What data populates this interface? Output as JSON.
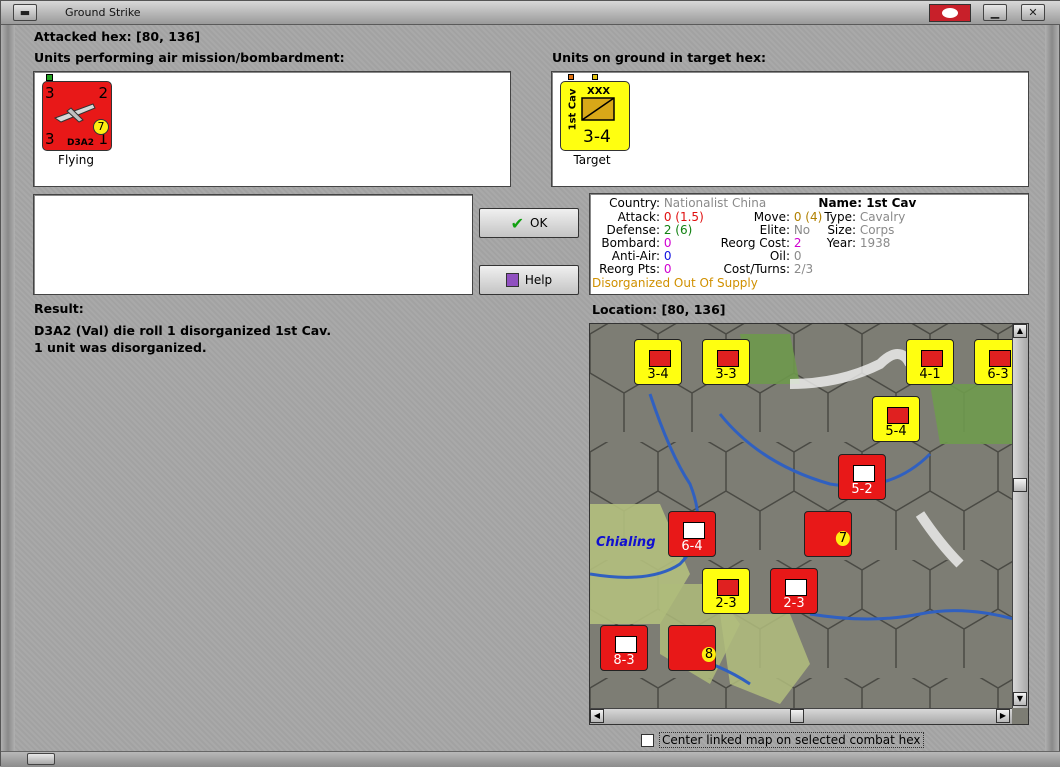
{
  "window": {
    "title": "Ground Strike"
  },
  "attacked_hex": "Attacked hex:  [80, 136]",
  "air_units_label": "Units performing air mission/bombardment:",
  "ground_units_label": "Units on ground in target hex:",
  "air_unit": {
    "name": "D3A2",
    "top_left": "3",
    "top_right": "2",
    "bottom_left": "3",
    "bottom_right": "1",
    "badge": "7",
    "caption": "Flying"
  },
  "ground_unit": {
    "name": "1st Cav",
    "size_mark": "XXX",
    "strength": "3-4",
    "caption": "Target"
  },
  "buttons": {
    "ok": "OK",
    "help": "Help"
  },
  "info": {
    "country_label": "Country:",
    "country": "Nationalist China",
    "attack_label": "Attack:",
    "attack": "0",
    "attack_mod": "(1.5)",
    "defense_label": "Defense:",
    "defense": "2",
    "defense_mod": "(6)",
    "bombard_label": "Bombard:",
    "bombard": "0",
    "antiair_label": "Anti-Air:",
    "antiair": "0",
    "reorg_label": "Reorg Pts:",
    "reorg": "0",
    "move_label": "Move:",
    "move": "0",
    "move_mod": "(4)",
    "elite_label": "Elite:",
    "elite": "No",
    "reorgcost_label": "Reorg Cost:",
    "reorgcost": "2",
    "oil_label": "Oil:",
    "oil": "0",
    "costturns_label": "Cost/Turns:",
    "costturns": "2/3",
    "name_label": "Name:",
    "name": "1st Cav",
    "type_label": "Type:",
    "type": "Cavalry",
    "size_label": "Size:",
    "size": "Corps",
    "year_label": "Year:",
    "year": "1938",
    "status": "Disorganized Out Of Supply"
  },
  "result": {
    "label": "Result:",
    "line1": "D3A2 (Val) die roll 1 disorganized 1st Cav.",
    "line2": "1 unit was disorganized."
  },
  "location_label": "Location:  [80, 136]",
  "map": {
    "place_label": "Chialing",
    "counters": [
      {
        "label": "3-4",
        "color": "yellow"
      },
      {
        "label": "3-3",
        "color": "yellow"
      },
      {
        "label": "4-1",
        "color": "yellow"
      },
      {
        "label": "6-3",
        "color": "yellow"
      },
      {
        "label": "5-4",
        "color": "yellow"
      },
      {
        "label": "5-2",
        "color": "red"
      },
      {
        "label": "6-4",
        "color": "red"
      },
      {
        "label": "2-3",
        "color": "yellow"
      },
      {
        "label": "2-3",
        "color": "red"
      },
      {
        "label": "8-3",
        "color": "red"
      },
      {
        "label": "8",
        "color": "red"
      },
      {
        "label": "7",
        "color": "red"
      }
    ]
  },
  "center_checkbox": {
    "label": "Center linked map on selected combat hex",
    "checked": false
  }
}
